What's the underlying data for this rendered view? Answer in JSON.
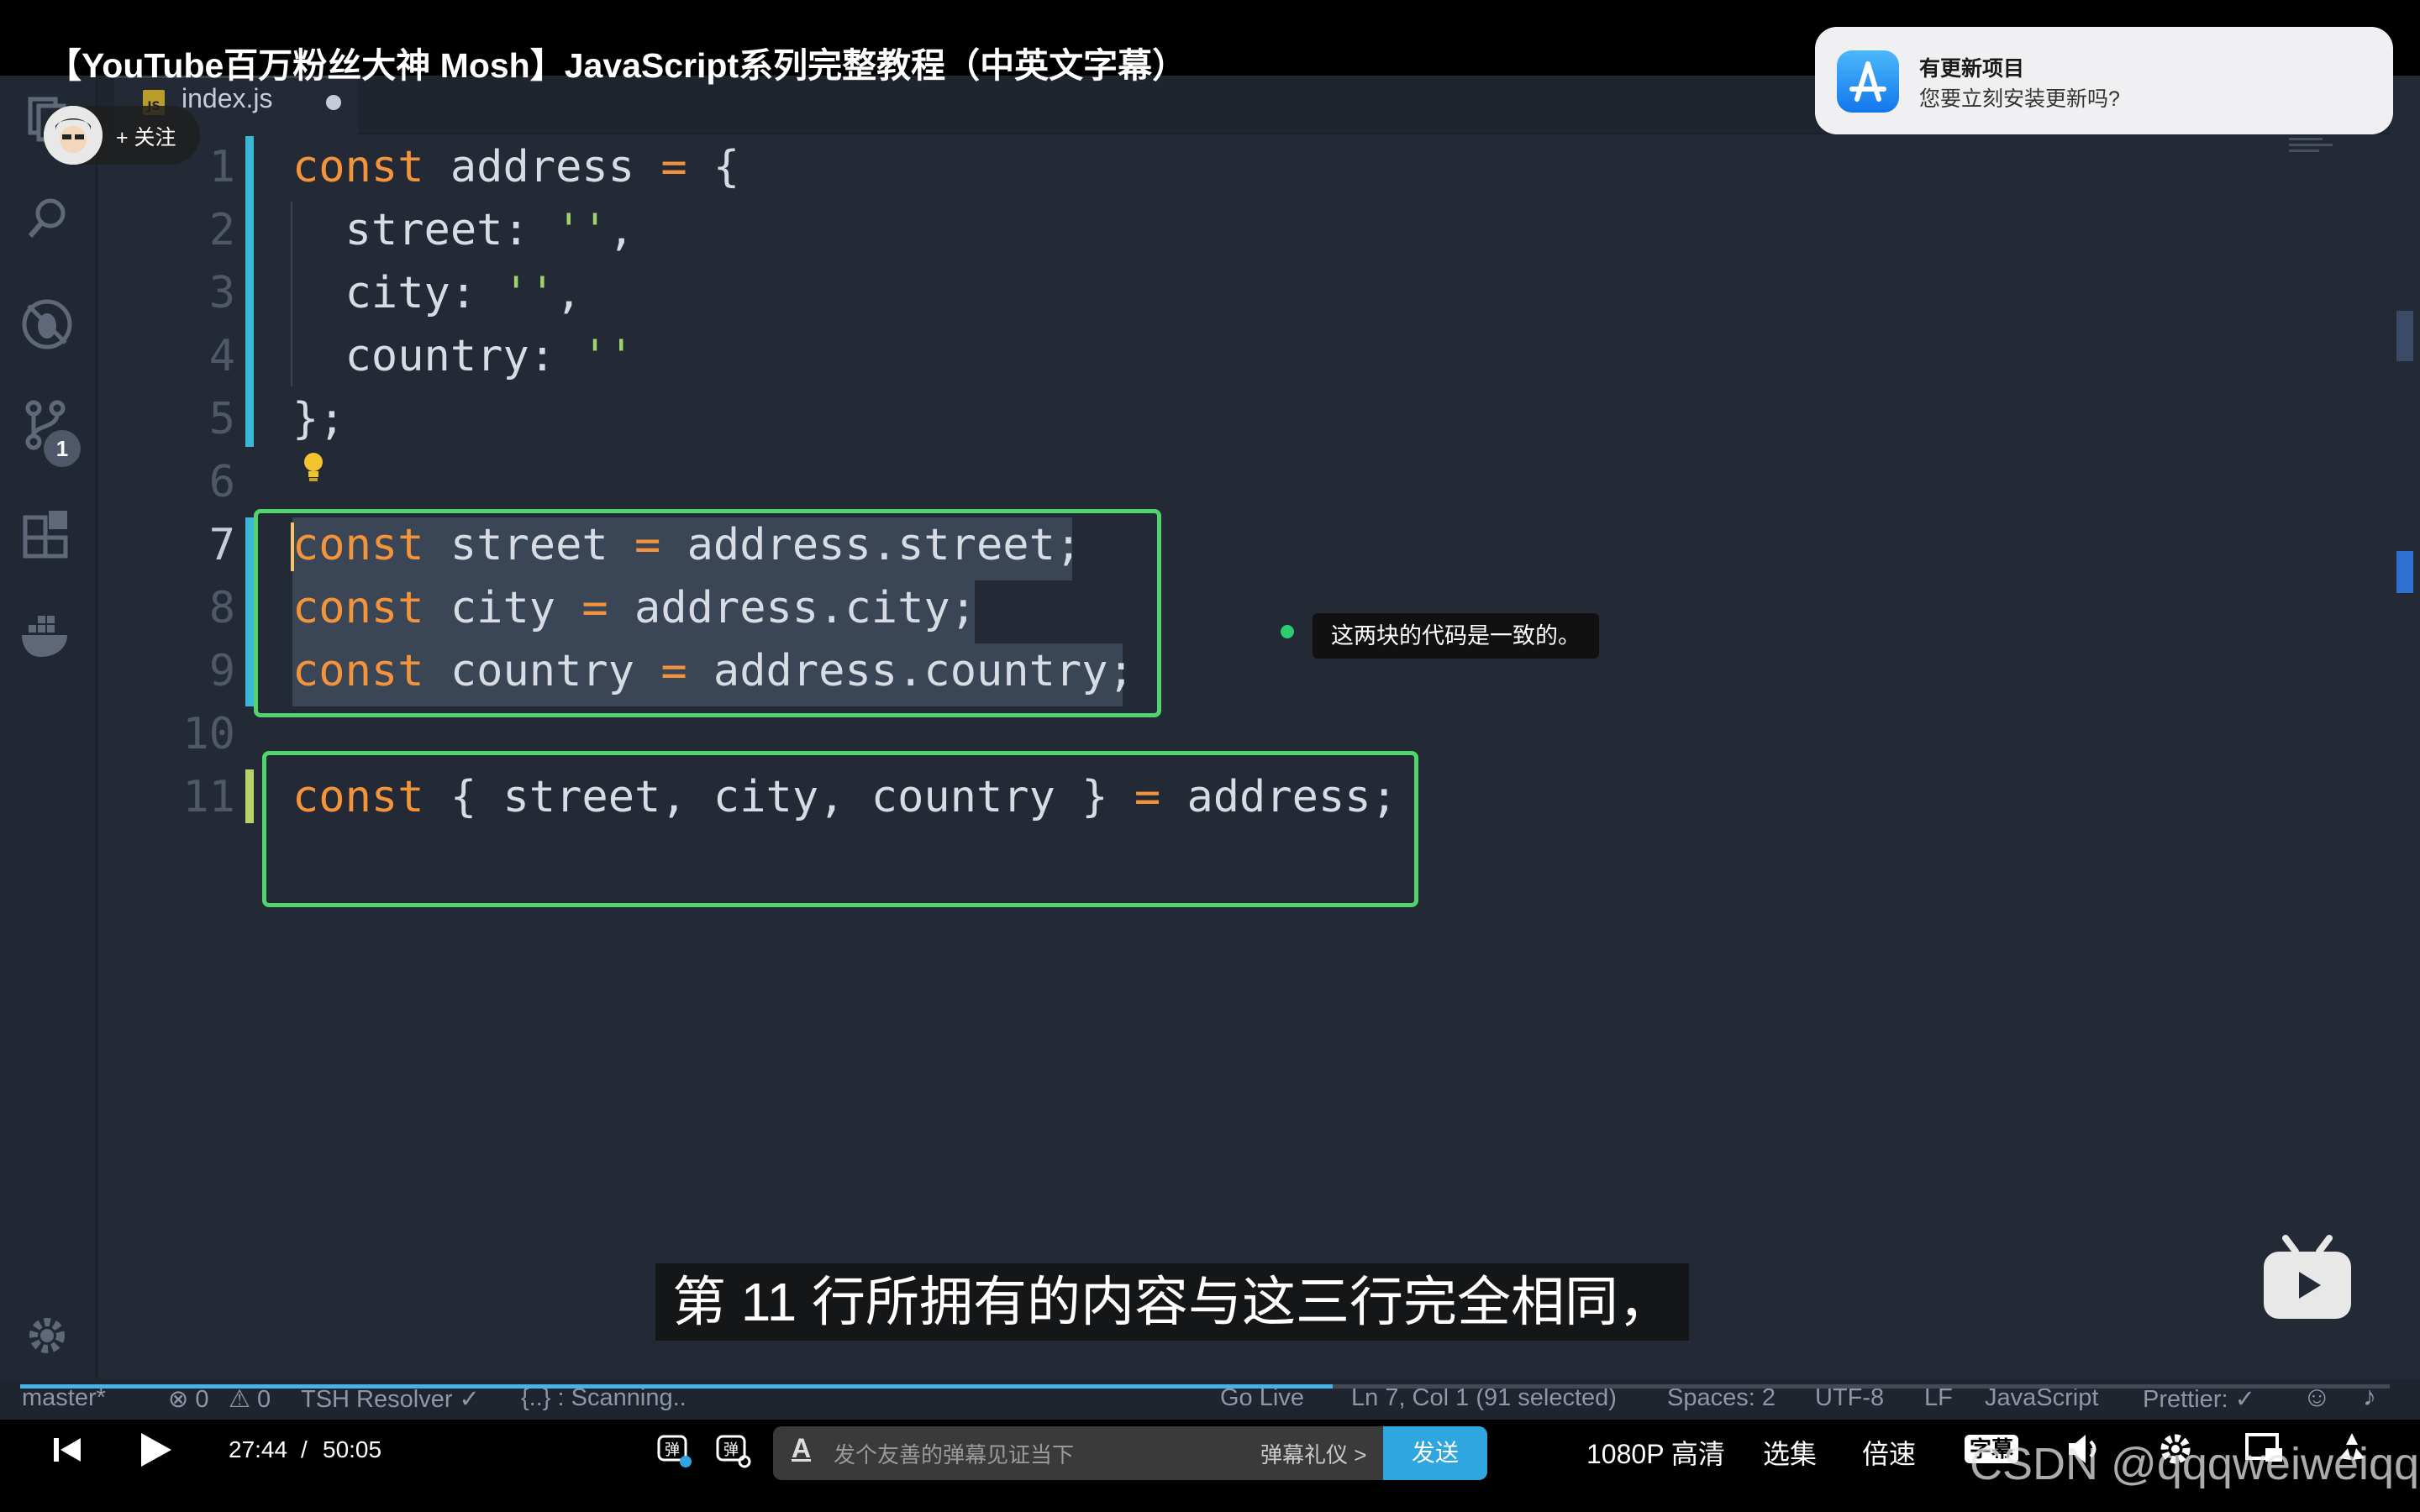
{
  "video": {
    "title": "【YouTube百万粉丝大神 Mosh】JavaScript系列完整教程（中英文字幕）",
    "uploader_follow": "+ 关注",
    "subtitle": "第 11 行所拥有的内容与这三行完全相同，",
    "tooltip": "这两块的代码是一致的。",
    "watermark": "CSDN @qqqweiweiqq"
  },
  "notification": {
    "title": "有更新项目",
    "body": "您要立刻安装更新吗?",
    "icon": "app-store-icon"
  },
  "editor": {
    "tab_icon": "JS",
    "tab_name": "index.js",
    "source_control_badge": "1",
    "lines": [
      {
        "n": "1",
        "text": "const address = {"
      },
      {
        "n": "2",
        "text": "  street: '',"
      },
      {
        "n": "3",
        "text": "  city: '',"
      },
      {
        "n": "4",
        "text": "  country: ''"
      },
      {
        "n": "5",
        "text": "};"
      },
      {
        "n": "6",
        "text": ""
      },
      {
        "n": "7",
        "text": "const street = address.street;"
      },
      {
        "n": "8",
        "text": "const city = address.city;"
      },
      {
        "n": "9",
        "text": "const country = address.country;"
      },
      {
        "n": "10",
        "text": ""
      },
      {
        "n": "11",
        "text": "const { street, city, country } = address;"
      }
    ]
  },
  "statusbar": {
    "branch": "master*",
    "errors": "⊗ 0",
    "warnings": "⚠ 0",
    "resolver": "TSH Resolver ✓",
    "scanning": "{..} : Scanning..",
    "go_live": "Go Live",
    "position": "Ln 7, Col 1 (91 selected)",
    "spaces": "Spaces: 2",
    "encoding": "UTF-8",
    "eol": "LF",
    "language": "JavaScript",
    "prettier": "Prettier: ✓"
  },
  "player": {
    "time_current": "27:44",
    "time_sep": "/",
    "time_total": "50:05",
    "danmu_placeholder": "发个友善的弹幕见证当下",
    "danmu_gift": "弹幕礼仪 >",
    "send_label": "发送",
    "quality": "1080P 高清",
    "episodes": "选集",
    "speed": "倍速",
    "subtitle_btn": "字幕",
    "progress_fraction": 0.554
  }
}
